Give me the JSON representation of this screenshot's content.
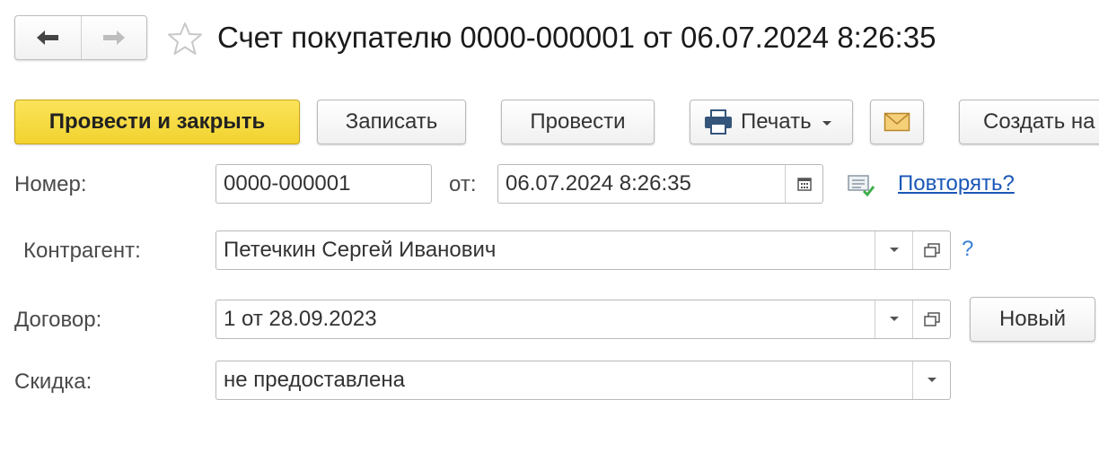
{
  "header": {
    "title": "Счет покупателю 0000-000001 от 06.07.2024 8:26:35"
  },
  "toolbar": {
    "post_close_label": "Провести и закрыть",
    "save_label": "Записать",
    "post_label": "Провести",
    "print_label": "Печать",
    "create_label": "Создать на"
  },
  "form": {
    "number_label": "Номер:",
    "number_value": "0000-000001",
    "date_label": "от:",
    "date_value": "06.07.2024  8:26:35",
    "repeat_link": "Повторять?",
    "counterparty_label": "Контрагент:",
    "counterparty_value": "Петечкин Сергей Иванович",
    "help_mark": "?",
    "contract_label": "Договор:",
    "contract_value": "1 от 28.09.2023",
    "new_button": "Новый",
    "discount_label": "Скидка:",
    "discount_value": "не предоставлена"
  },
  "colors": {
    "primary_button": "#f2d22f",
    "link": "#1a57b8"
  }
}
